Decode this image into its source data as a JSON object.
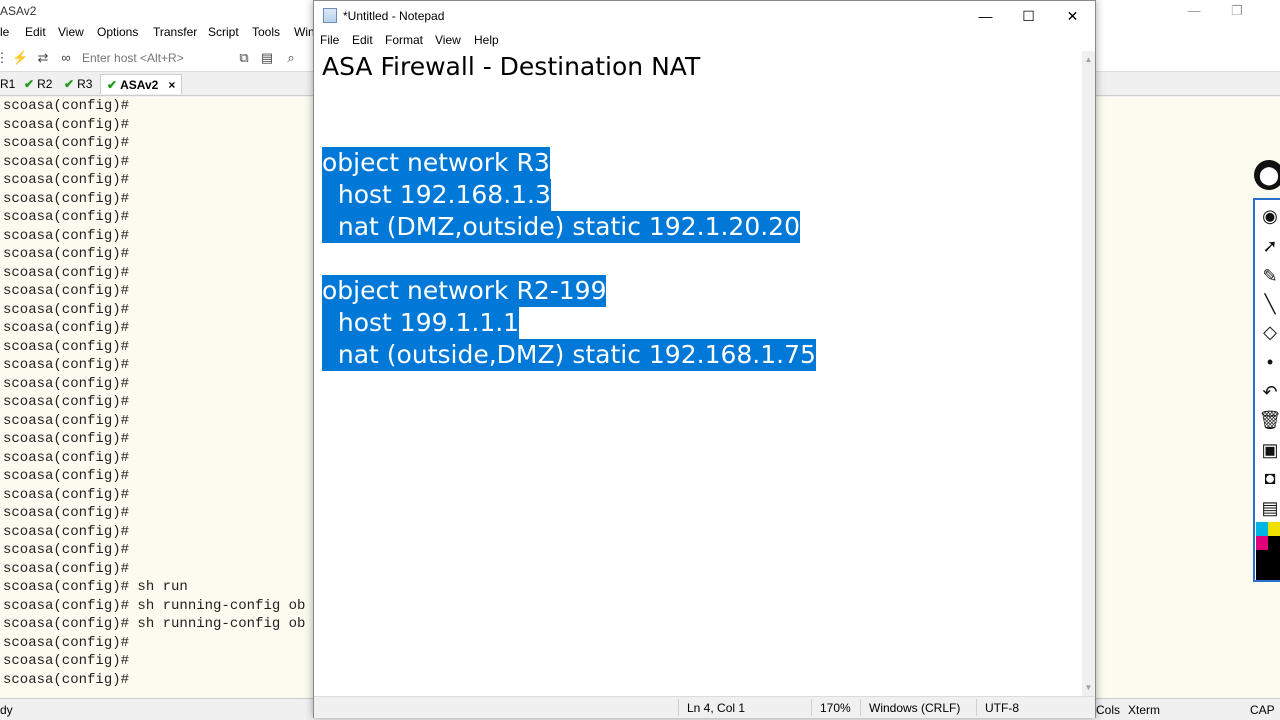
{
  "crt": {
    "title": "ASAv2",
    "menu": [
      "le",
      "Edit",
      "View",
      "Options",
      "Transfer",
      "Script",
      "Tools",
      "Win"
    ],
    "host_placeholder": "Enter host <Alt+R>",
    "tabs": [
      {
        "label": "R1",
        "checked": false
      },
      {
        "label": "R2",
        "checked": true
      },
      {
        "label": "R3",
        "checked": true
      },
      {
        "label": "ASAv2",
        "checked": true,
        "active": true
      }
    ],
    "tab_close": "×",
    "terminal_lines": [
      "scoasa(config)#",
      "scoasa(config)#",
      "scoasa(config)#",
      "scoasa(config)#",
      "scoasa(config)#",
      "scoasa(config)#",
      "scoasa(config)#",
      "scoasa(config)#",
      "scoasa(config)#",
      "scoasa(config)#",
      "scoasa(config)#",
      "scoasa(config)#",
      "scoasa(config)#",
      "scoasa(config)#",
      "scoasa(config)#",
      "scoasa(config)#",
      "scoasa(config)#",
      "scoasa(config)#",
      "scoasa(config)#",
      "scoasa(config)#",
      "scoasa(config)#",
      "scoasa(config)#",
      "scoasa(config)#",
      "scoasa(config)#",
      "scoasa(config)#",
      "scoasa(config)#",
      "scoasa(config)# sh run",
      "scoasa(config)# sh running-config ob",
      "scoasa(config)# sh running-config ob",
      "scoasa(config)#",
      "scoasa(config)#",
      "scoasa(config)#"
    ],
    "status": {
      "left": "dy",
      "cols": "Cols",
      "term": "Xterm",
      "cap": "CAP"
    }
  },
  "notepad": {
    "title": "*Untitled - Notepad",
    "window_buttons": {
      "minimize": "—",
      "maximize": "☐",
      "close": "✕"
    },
    "menu": [
      "File",
      "Edit",
      "Format",
      "View",
      "Help"
    ],
    "lines": [
      {
        "text": "ASA Firewall - Destination NAT",
        "selected": false
      },
      {
        "text": "",
        "selected": false
      },
      {
        "text": "",
        "selected": false
      },
      {
        "text": "object network R3",
        "selected": true
      },
      {
        "text": "  host 192.168.1.3",
        "selected": true
      },
      {
        "text": "  nat (DMZ,outside) static 192.1.20.20",
        "selected": true
      },
      {
        "text": "",
        "selected": false
      },
      {
        "text": "object network R2-199",
        "selected": true
      },
      {
        "text": "  host 199.1.1.1",
        "selected": true
      },
      {
        "text": "  nat (outside,DMZ) static 192.168.1.75",
        "selected": true
      }
    ],
    "status": {
      "position": "Ln 4, Col 1",
      "zoom": "170%",
      "line_endings": "Windows (CRLF)",
      "encoding": "UTF-8"
    },
    "selection_color": "#0078d7"
  },
  "draw_tools": [
    "eye-icon",
    "pointer-icon",
    "pencil-icon",
    "line-icon",
    "eraser-icon",
    "dot-icon",
    "undo-icon",
    "trash-icon",
    "screen-icon",
    "camera-icon",
    "clipboard-icon"
  ],
  "palette": [
    "#00b4e6",
    "#f0e000",
    "#e0007a",
    "#000000",
    "#000000",
    "#000000"
  ]
}
